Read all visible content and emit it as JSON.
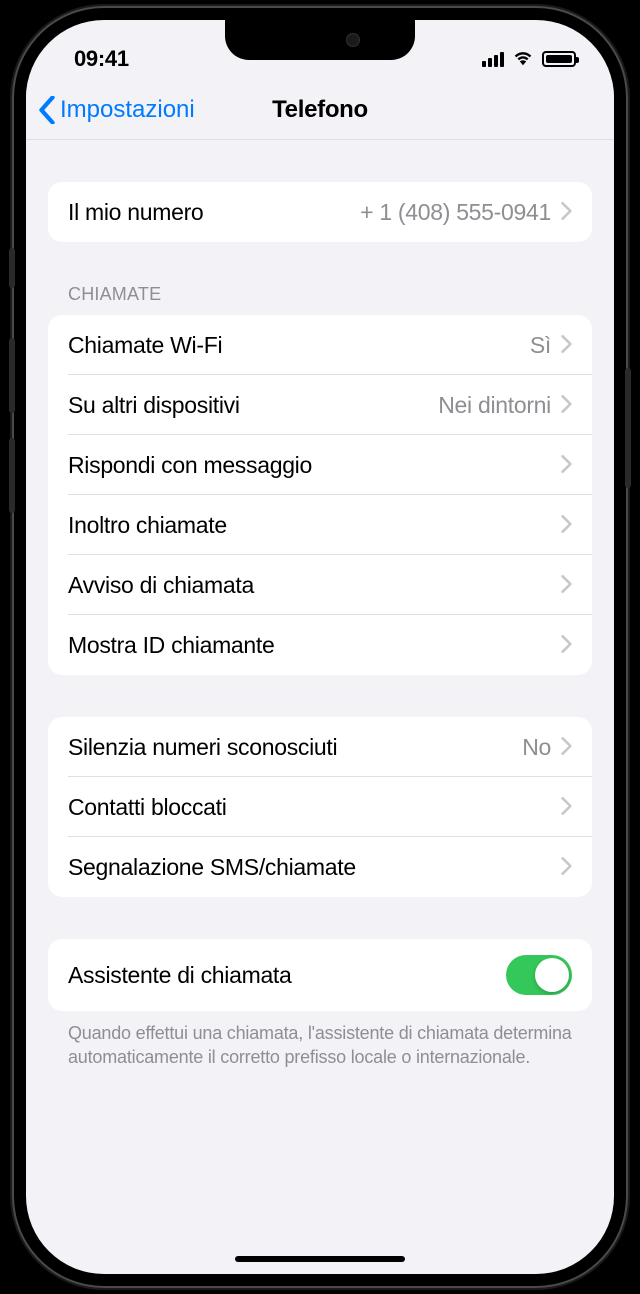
{
  "status": {
    "time": "09:41"
  },
  "nav": {
    "back_label": "Impostazioni",
    "title": "Telefono"
  },
  "sections": {
    "my_number": {
      "label": "Il mio numero",
      "value": "+ 1 (408) 555-0941"
    },
    "calls": {
      "header": "CHIAMATE",
      "items": [
        {
          "label": "Chiamate Wi-Fi",
          "value": "Sì"
        },
        {
          "label": "Su altri dispositivi",
          "value": "Nei dintorni"
        },
        {
          "label": "Rispondi con messaggio",
          "value": ""
        },
        {
          "label": "Inoltro chiamate",
          "value": ""
        },
        {
          "label": "Avviso di chiamata",
          "value": ""
        },
        {
          "label": "Mostra ID chiamante",
          "value": ""
        }
      ]
    },
    "silence": {
      "items": [
        {
          "label": "Silenzia numeri sconosciuti",
          "value": "No"
        },
        {
          "label": "Contatti bloccati",
          "value": ""
        },
        {
          "label": "Segnalazione SMS/chiamate",
          "value": ""
        }
      ]
    },
    "assist": {
      "label": "Assistente di chiamata",
      "enabled": true,
      "footer": "Quando effettui una chiamata, l'assistente di chiamata determina automaticamente il corretto prefisso locale o internazionale."
    }
  }
}
